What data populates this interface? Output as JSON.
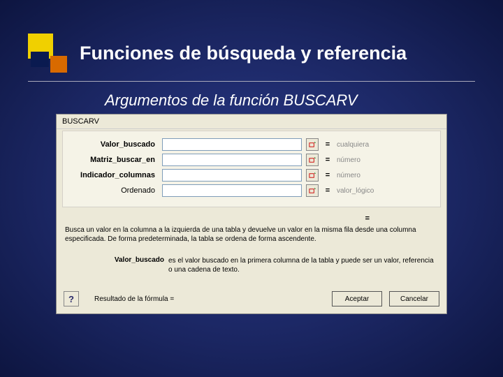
{
  "slide": {
    "title": "Funciones de búsqueda y referencia",
    "subtitle": "Argumentos de la función BUSCARV"
  },
  "dialog": {
    "function_name": "BUSCARV",
    "args": [
      {
        "label": "Valor_buscado",
        "bold": true,
        "type_hint": "cualquiera"
      },
      {
        "label": "Matriz_buscar_en",
        "bold": true,
        "type_hint": "número"
      },
      {
        "label": "Indicador_columnas",
        "bold": true,
        "type_hint": "número"
      },
      {
        "label": "Ordenado",
        "bold": false,
        "type_hint": "valor_lógico"
      }
    ],
    "eq_sign": "=",
    "description": "Busca un valor en la columna a la izquierda de una tabla y devuelve un valor en la misma fila desde una columna especificada. De forma predeterminada, la tabla se ordena de forma ascendente.",
    "param_help_label": "Valor_buscado",
    "param_help_text": "es el valor buscado en la primera columna de la tabla y puede ser un valor, referencia o una cadena de texto.",
    "result_label": "Resultado de la fórmula =",
    "help_glyph": "?",
    "buttons": {
      "ok": "Aceptar",
      "cancel": "Cancelar"
    }
  }
}
